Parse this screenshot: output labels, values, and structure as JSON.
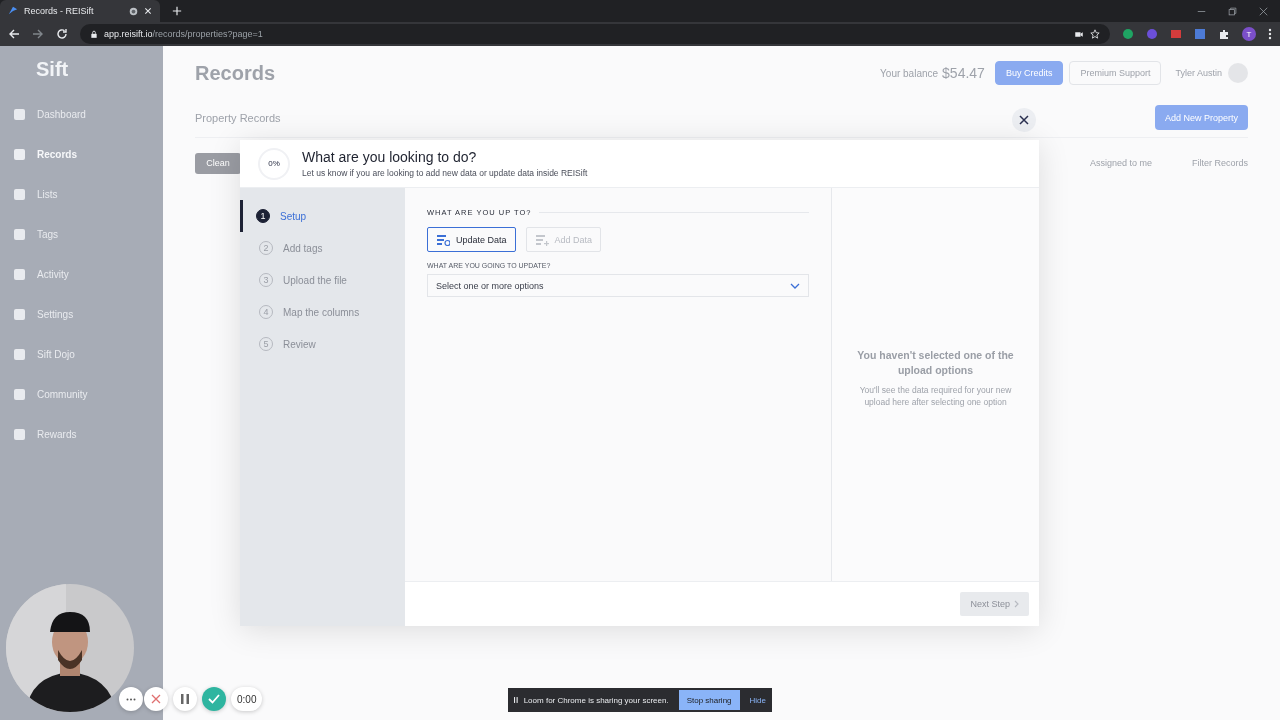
{
  "browser": {
    "tab_title": "Records - REISift",
    "url_host": "app.reisift.io",
    "url_path": "/records/properties?page=1",
    "profile_initial": "T"
  },
  "sidebar": {
    "logo": "Sift",
    "items": [
      {
        "label": "Dashboard",
        "selected": false
      },
      {
        "label": "Records",
        "selected": true
      },
      {
        "label": "Lists",
        "selected": false
      },
      {
        "label": "Tags",
        "selected": false
      },
      {
        "label": "Activity",
        "selected": false
      },
      {
        "label": "Settings",
        "selected": false
      },
      {
        "label": "Sift Dojo",
        "selected": false
      },
      {
        "label": "Community",
        "selected": false
      },
      {
        "label": "Rewards",
        "selected": false
      }
    ]
  },
  "header": {
    "title": "Records",
    "balance_label": "Your balance",
    "balance": "$54.47",
    "buttons": [
      "Buy Credits",
      "Premium Support"
    ],
    "user": "Tyler Austin"
  },
  "tabs": [
    {
      "label": "Property Records",
      "selected": true
    }
  ],
  "toolbar": {
    "clean": "Clean",
    "add": "Add New Property",
    "assigned": "Assigned to me",
    "filter": "Filter Records"
  },
  "modal": {
    "progress": "0%",
    "title": "What are you looking to do?",
    "subtitle": "Let us know if you are looking to add new data or update data inside REISift",
    "steps": [
      {
        "number": "1",
        "label": "Setup",
        "selected": true
      },
      {
        "number": "2",
        "label": "Add tags",
        "selected": false
      },
      {
        "number": "3",
        "label": "Upload the file",
        "selected": false
      },
      {
        "number": "4",
        "label": "Map the columns",
        "selected": false
      },
      {
        "number": "5",
        "label": "Review",
        "selected": false
      }
    ],
    "section_label": "WHAT ARE YOU UP TO?",
    "options": [
      {
        "label": "Update Data",
        "kind": "update",
        "selected": true
      },
      {
        "label": "Add Data",
        "kind": "add",
        "selected": false
      }
    ],
    "select_label": "WHAT ARE YOU GOING TO UPDATE?",
    "select_placeholder": "Select one or more options",
    "empty_title": "You haven't selected one of the upload options",
    "empty_text": "You'll see the data required for your new upload here after selecting one option",
    "next_button": "Next Step"
  },
  "recorder": {
    "timer": "0:00",
    "banner": "Loom for Chrome is sharing your screen.",
    "stop": "Stop sharing",
    "hide": "Hide"
  }
}
